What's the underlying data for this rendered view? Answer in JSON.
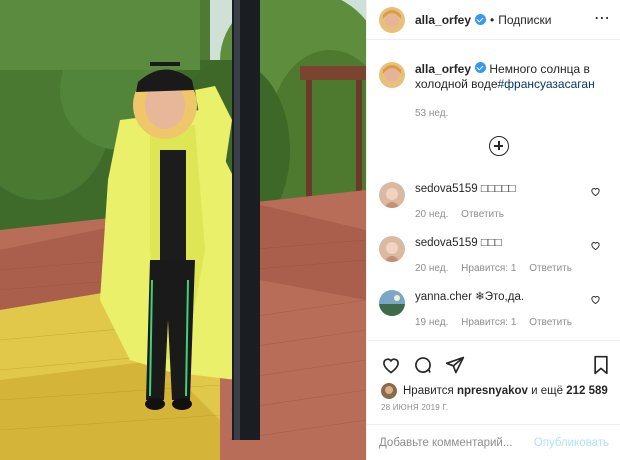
{
  "header": {
    "username": "alla_orfey",
    "separator": "•",
    "follow_label": "Подписки",
    "more_icon": "more-horizontal-icon"
  },
  "caption": {
    "username": "alla_orfey",
    "text": "Немного солнца в холодной воде",
    "hashtag": "#франсуазасаган",
    "time": "53 нед."
  },
  "load_more_icon": "plus-circle-icon",
  "comments": [
    {
      "username": "sedova5159",
      "text": "□□□□□",
      "time": "20 нед.",
      "likes": "",
      "reply": "Ответить"
    },
    {
      "username": "sedova5159",
      "text": "□□□",
      "time": "20 нед.",
      "likes": "Нравится: 1",
      "reply": "Ответить"
    },
    {
      "username": "yanna.cher",
      "text": "❄Это,да.",
      "time": "19 нед.",
      "likes": "Нравится: 1",
      "reply": "Ответить"
    }
  ],
  "actions": {
    "icons": [
      "heart-icon",
      "comment-icon",
      "share-icon",
      "bookmark-icon"
    ]
  },
  "likes": {
    "prefix": "Нравится",
    "user": "npresnyakov",
    "middle": "и ещё",
    "count": "212 589"
  },
  "post_date": "28 ИЮНЯ 2019 Г.",
  "add_comment": {
    "placeholder": "Добавьте комментарий...",
    "publish_label": "Опубликовать"
  },
  "colors": {
    "link": "#00376b",
    "verified": "#3897f0",
    "secondary_text": "#8e8e8e",
    "publish_disabled": "#b2dffc"
  }
}
